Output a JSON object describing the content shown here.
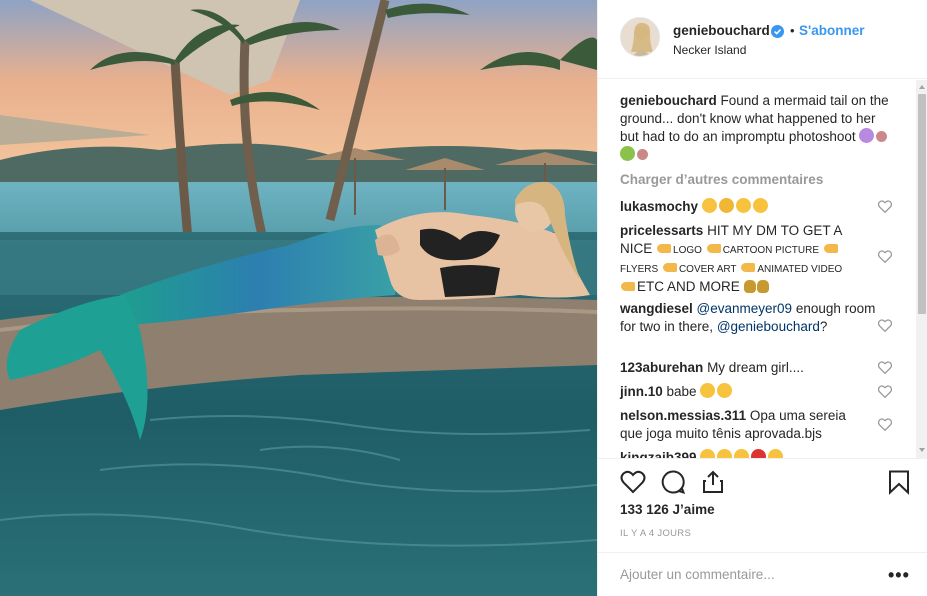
{
  "post": {
    "username": "geniebouchard",
    "follow_label": "S'abonner",
    "dot": "•",
    "location": "Necker Island",
    "caption_user": "geniebouchard",
    "caption_text": "Found a mermaid tail on the ground... don't know what happened to her but had to do an impromptu photoshoot",
    "load_more": "Charger d’autres commentaires",
    "likes": "133 126 J’aime",
    "time": "IL Y A 4 JOURS",
    "add_comment_placeholder": "Ajouter un commentaire...",
    "more_dots": "•••"
  },
  "comments": [
    {
      "user": "lukasmochy",
      "text": ""
    },
    {
      "user": "pricelessarts",
      "text": "HIT MY DM TO GET A NICE",
      "parts": [
        "LOGO",
        "CARTOON PICTURE",
        "FLYERS",
        "COVER ART",
        "ANIMATED VIDEO",
        "ETC AND MORE"
      ]
    },
    {
      "user": "wangdiesel",
      "mention1": "@evanmeyer09",
      "text": "enough room for two in there,",
      "mention2": "@geniebouchard",
      "tail": "?"
    },
    {
      "user": "123aburehan",
      "text": "My dream girl...."
    },
    {
      "user": "jinn.10",
      "text": "babe"
    },
    {
      "user": "nelson.messias.311",
      "text": "Opa uma sereia que joga muito tênis aprovada.bjs"
    },
    {
      "user": "kingzaib399",
      "text": ""
    }
  ],
  "icons": {
    "verified": "verified-badge-icon",
    "like": "heart-icon",
    "comment": "comment-bubble-icon",
    "share": "share-icon",
    "save": "bookmark-icon"
  },
  "colors": {
    "accent": "#3897f0",
    "text": "#262626",
    "muted": "#999999",
    "border": "#efefef"
  }
}
